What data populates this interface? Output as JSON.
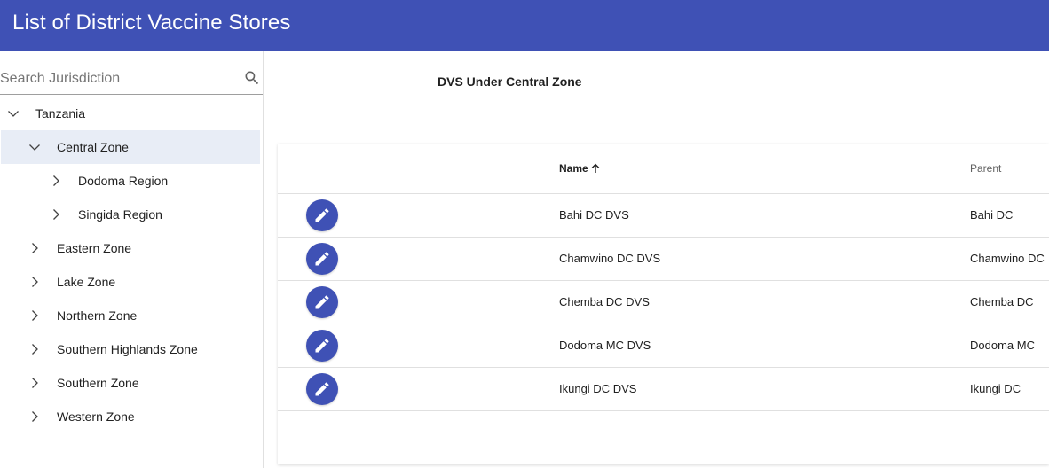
{
  "app": {
    "title": "List of District Vaccine Stores"
  },
  "sidebar": {
    "search": {
      "placeholder": "Search Jurisdiction",
      "value": ""
    },
    "tree": [
      {
        "label": "Tanzania",
        "expanded": true,
        "selected": false
      },
      {
        "label": "Central Zone",
        "expanded": true,
        "selected": true
      },
      {
        "label": "Dodoma Region",
        "expanded": false,
        "selected": false
      },
      {
        "label": "Singida Region",
        "expanded": false,
        "selected": false
      },
      {
        "label": "Eastern Zone",
        "expanded": false,
        "selected": false
      },
      {
        "label": "Lake Zone",
        "expanded": false,
        "selected": false
      },
      {
        "label": "Northern Zone",
        "expanded": false,
        "selected": false
      },
      {
        "label": "Southern Highlands Zone",
        "expanded": false,
        "selected": false
      },
      {
        "label": "Southern Zone",
        "expanded": false,
        "selected": false
      },
      {
        "label": "Western Zone",
        "expanded": false,
        "selected": false
      }
    ]
  },
  "main": {
    "title": "DVS Under Central Zone",
    "table": {
      "columns": {
        "name": "Name",
        "parent": "Parent"
      },
      "sort": {
        "column": "name",
        "direction": "ascending"
      },
      "rows": [
        {
          "name": "Bahi DC DVS",
          "parent": "Bahi DC"
        },
        {
          "name": "Chamwino DC DVS",
          "parent": "Chamwino DC"
        },
        {
          "name": "Chemba DC DVS",
          "parent": "Chemba DC"
        },
        {
          "name": "Dodoma MC DVS",
          "parent": "Dodoma MC"
        },
        {
          "name": "Ikungi DC DVS",
          "parent": "Ikungi DC"
        }
      ]
    }
  },
  "colors": {
    "primary": "#3f51b5",
    "selected_row": "#e8edf6",
    "text": "#212121",
    "secondary_text": "#616161"
  },
  "icons": {
    "search": "search-icon",
    "expanded": "chevron-down-icon",
    "collapsed": "chevron-right-icon",
    "edit": "pencil-icon",
    "sort": "arrow-up-icon"
  }
}
